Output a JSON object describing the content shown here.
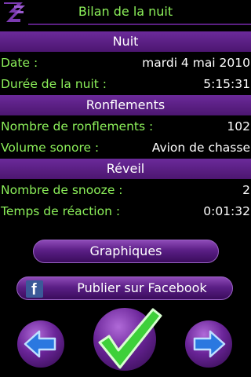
{
  "header": {
    "title": "Bilan de la nuit",
    "logo_icon": "zz-sleep-logo-icon"
  },
  "sections": {
    "nuit": {
      "title": "Nuit",
      "rows": [
        {
          "label": "Date :",
          "value": "mardi 4 mai 2010"
        },
        {
          "label": "Durée de la nuit :",
          "value": "5:15:31"
        }
      ]
    },
    "ronflements": {
      "title": "Ronflements",
      "rows": [
        {
          "label": "Nombre de ronflements :",
          "value": "102"
        },
        {
          "label": "Volume sonore :",
          "value": "Avion de chasse"
        }
      ]
    },
    "reveil": {
      "title": "Réveil",
      "rows": [
        {
          "label": "Nombre de snooze :",
          "value": "2"
        },
        {
          "label": "Temps de réaction :",
          "value": "0:01:32"
        }
      ]
    }
  },
  "buttons": {
    "graphiques": "Graphiques",
    "facebook": "Publier sur Facebook",
    "facebook_icon": "facebook-icon",
    "back_icon": "left-arrow-icon",
    "confirm_icon": "checkmark-icon",
    "next_icon": "right-arrow-icon"
  },
  "colors": {
    "label_green": "#8cf05a",
    "section_purple": "#5a1f82",
    "background": "#000000"
  }
}
